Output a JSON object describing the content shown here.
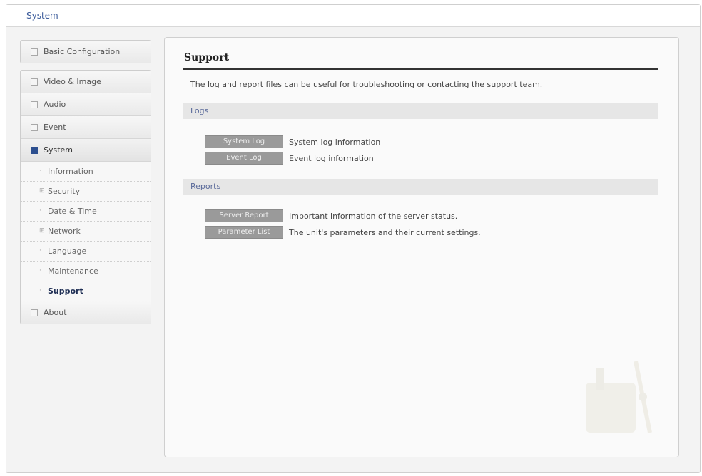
{
  "header": {
    "title": "System"
  },
  "sidebar": {
    "top": {
      "label": "Basic Configuration"
    },
    "items": [
      {
        "label": "Video & Image"
      },
      {
        "label": "Audio"
      },
      {
        "label": "Event"
      },
      {
        "label": "System"
      }
    ],
    "system_sub": [
      {
        "label": "Information",
        "marker": "·"
      },
      {
        "label": "Security",
        "marker": "⊞"
      },
      {
        "label": "Date & Time",
        "marker": "·"
      },
      {
        "label": "Network",
        "marker": "⊞"
      },
      {
        "label": "Language",
        "marker": "·"
      },
      {
        "label": "Maintenance",
        "marker": "·"
      },
      {
        "label": "Support",
        "marker": "·"
      }
    ],
    "about": {
      "label": "About"
    }
  },
  "main": {
    "title": "Support",
    "intro": "The log and report files can be useful for troubleshooting or contacting the support team.",
    "logs": {
      "heading": "Logs",
      "rows": [
        {
          "button": "System Log",
          "desc": "System log information"
        },
        {
          "button": "Event Log",
          "desc": "Event log information"
        }
      ]
    },
    "reports": {
      "heading": "Reports",
      "rows": [
        {
          "button": "Server Report",
          "desc": "Important information of the server status."
        },
        {
          "button": "Parameter List",
          "desc": "The unit's parameters and their current settings."
        }
      ]
    }
  }
}
